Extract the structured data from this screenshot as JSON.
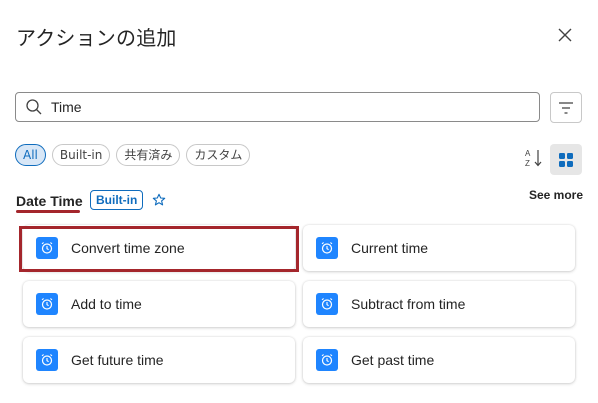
{
  "dialog": {
    "title": "アクションの追加"
  },
  "search": {
    "value": "Time",
    "placeholder": ""
  },
  "filters": {
    "chips": [
      "All",
      "Built-in",
      "共有済み",
      "カスタム"
    ],
    "selected": "All"
  },
  "section": {
    "title": "Date Time",
    "badge": "Built-in",
    "see_more": "See more"
  },
  "actions": [
    {
      "label": "Convert time zone",
      "highlighted": true
    },
    {
      "label": "Current time"
    },
    {
      "label": "Add to time"
    },
    {
      "label": "Subtract from time"
    },
    {
      "label": "Get future time"
    },
    {
      "label": "Get past time"
    }
  ],
  "colors": {
    "accent": "#0f6cbd",
    "action_icon": "#1f85ff",
    "highlight": "#a4262c"
  },
  "icons": {
    "close": "close-icon",
    "search": "search-icon",
    "filter": "filter-icon",
    "sort": "sort-az-icon",
    "grid": "grid-view-icon",
    "favorite": "star-icon",
    "action": "alarm-clock-icon"
  }
}
